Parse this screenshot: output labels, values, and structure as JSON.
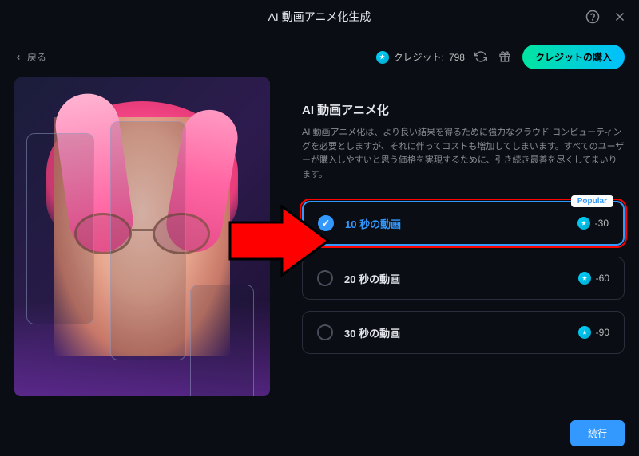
{
  "topbar": {
    "title": "AI 動画アニメ化生成"
  },
  "header": {
    "back_label": "戻る",
    "credit_label": "クレジット:",
    "credit_value": "798",
    "buy_credits_label": "クレジットの購入"
  },
  "panel": {
    "title": "AI 動画アニメ化",
    "description": "AI 動画アニメ化は、より良い結果を得るために強力なクラウド コンピューティングを必要としますが、それに伴ってコストも増加してしまいます。すべてのユーザーが購入しやすいと思う価格を実現するために、引き続き最善を尽くしてまいります。"
  },
  "options": [
    {
      "label": "10 秒の動画",
      "cost": "-30",
      "selected": true,
      "popular": true,
      "popular_text": "Popular"
    },
    {
      "label": "20 秒の動画",
      "cost": "-60",
      "selected": false,
      "popular": false
    },
    {
      "label": "30 秒の動画",
      "cost": "-90",
      "selected": false,
      "popular": false
    }
  ],
  "footer": {
    "continue_label": "続行"
  },
  "colors": {
    "accent": "#3399ff",
    "highlight_outline": "#ff0000",
    "buy_gradient_start": "#00e5a0",
    "buy_gradient_end": "#00bfff"
  }
}
